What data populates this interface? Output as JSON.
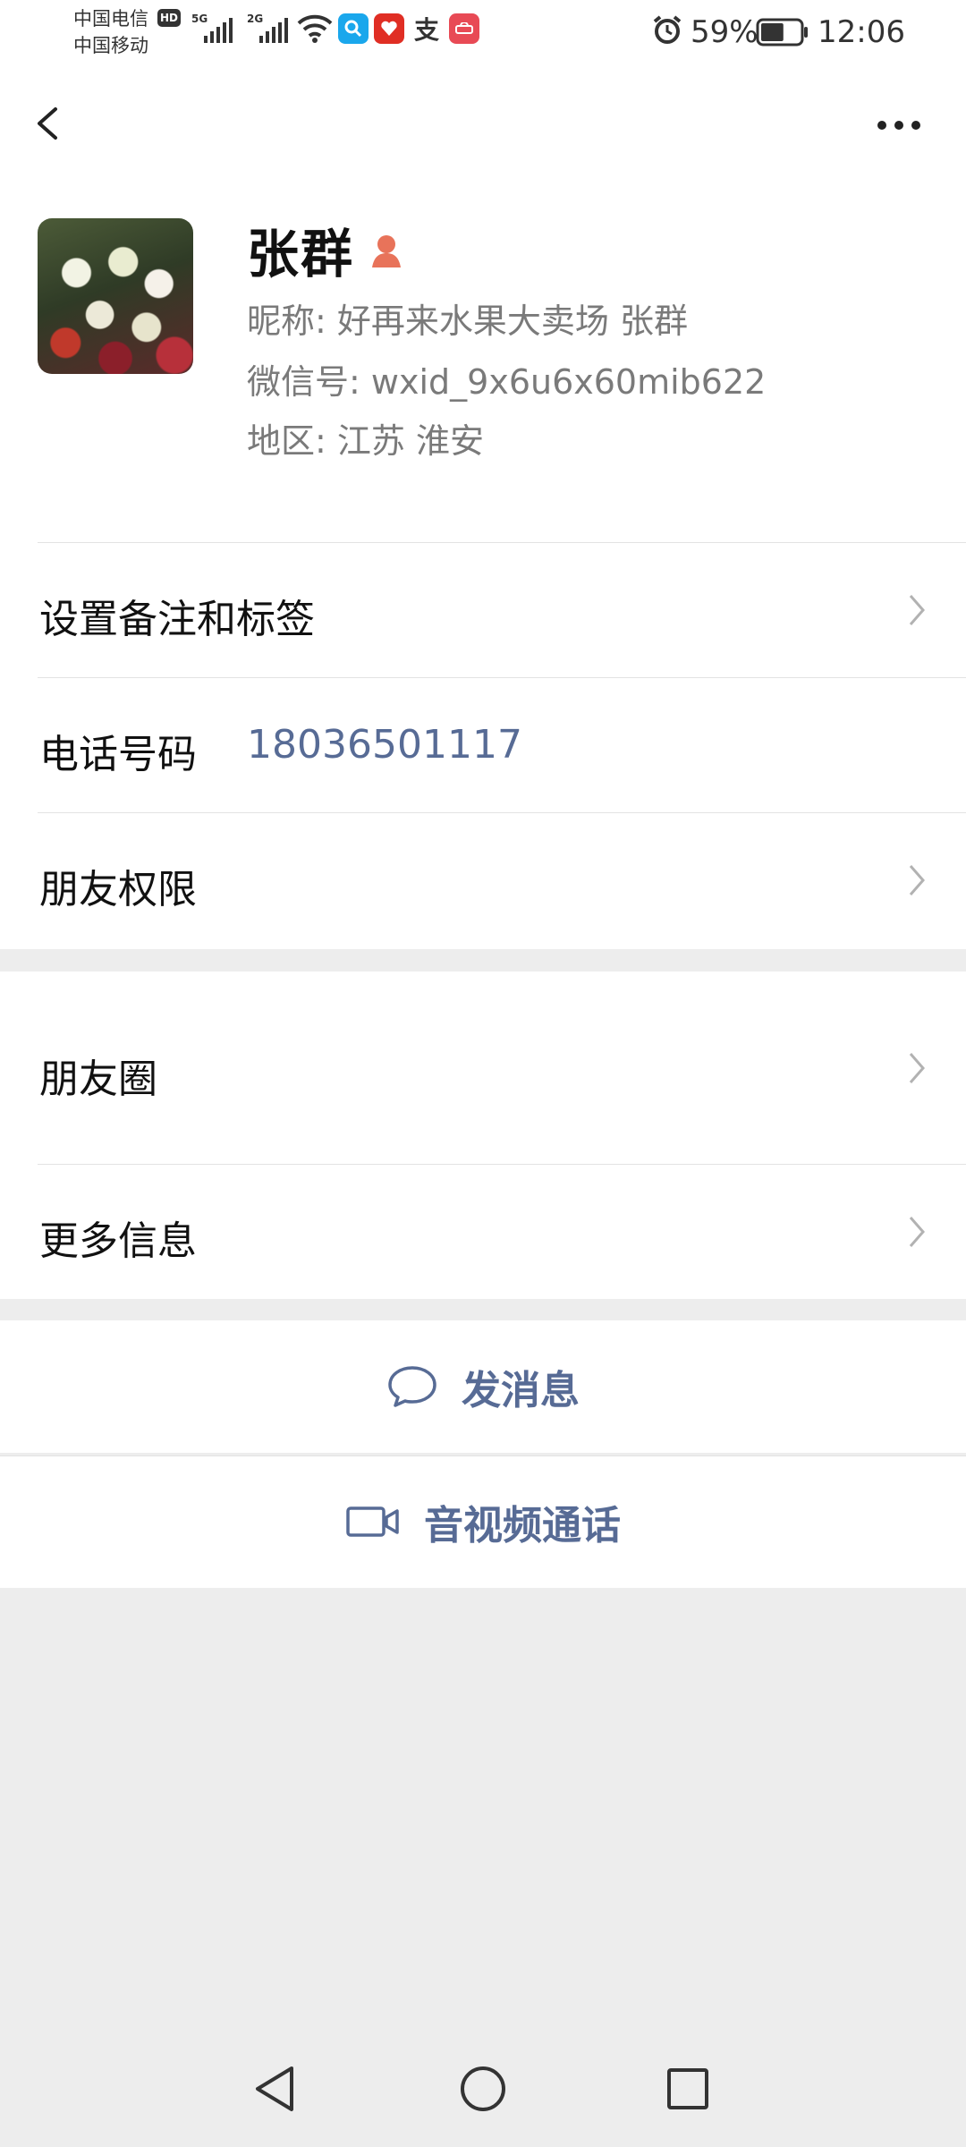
{
  "status_bar": {
    "carrier_1": "中国电信",
    "carrier_2": "中国移动",
    "hd_badge": "HD",
    "network_1": "5G",
    "network_2": "2G",
    "battery_percent": "59%",
    "battery_level": 0.59,
    "time": "12:06",
    "icons": [
      "signal-icon",
      "wifi-icon",
      "search-app-icon",
      "pinduoduo-app-icon",
      "alipay-app-icon",
      "huawei-app-icon",
      "alarm-icon",
      "battery-icon"
    ]
  },
  "header": {
    "back_icon": "back-chevron-icon",
    "more_icon": "more-dots-icon"
  },
  "profile": {
    "name": "张群",
    "gender_icon": "female-person-icon",
    "nickname_label": "昵称:",
    "nickname": "好再来水果大卖场 张群",
    "wechat_id_label": "微信号:",
    "wechat_id": "wxid_9x6u6x60mib622",
    "region_label": "地区:",
    "region": "江苏 淮安"
  },
  "rows": {
    "remark": "设置备注和标签",
    "phone_label": "电话号码",
    "phone_value": "18036501117",
    "permissions": "朋友权限",
    "moments": "朋友圈",
    "more_info": "更多信息"
  },
  "actions": {
    "message": "发消息",
    "call": "音视频通话"
  },
  "colors": {
    "link": "#576b95",
    "background": "#ededed",
    "gender_icon": "#e8735a"
  }
}
